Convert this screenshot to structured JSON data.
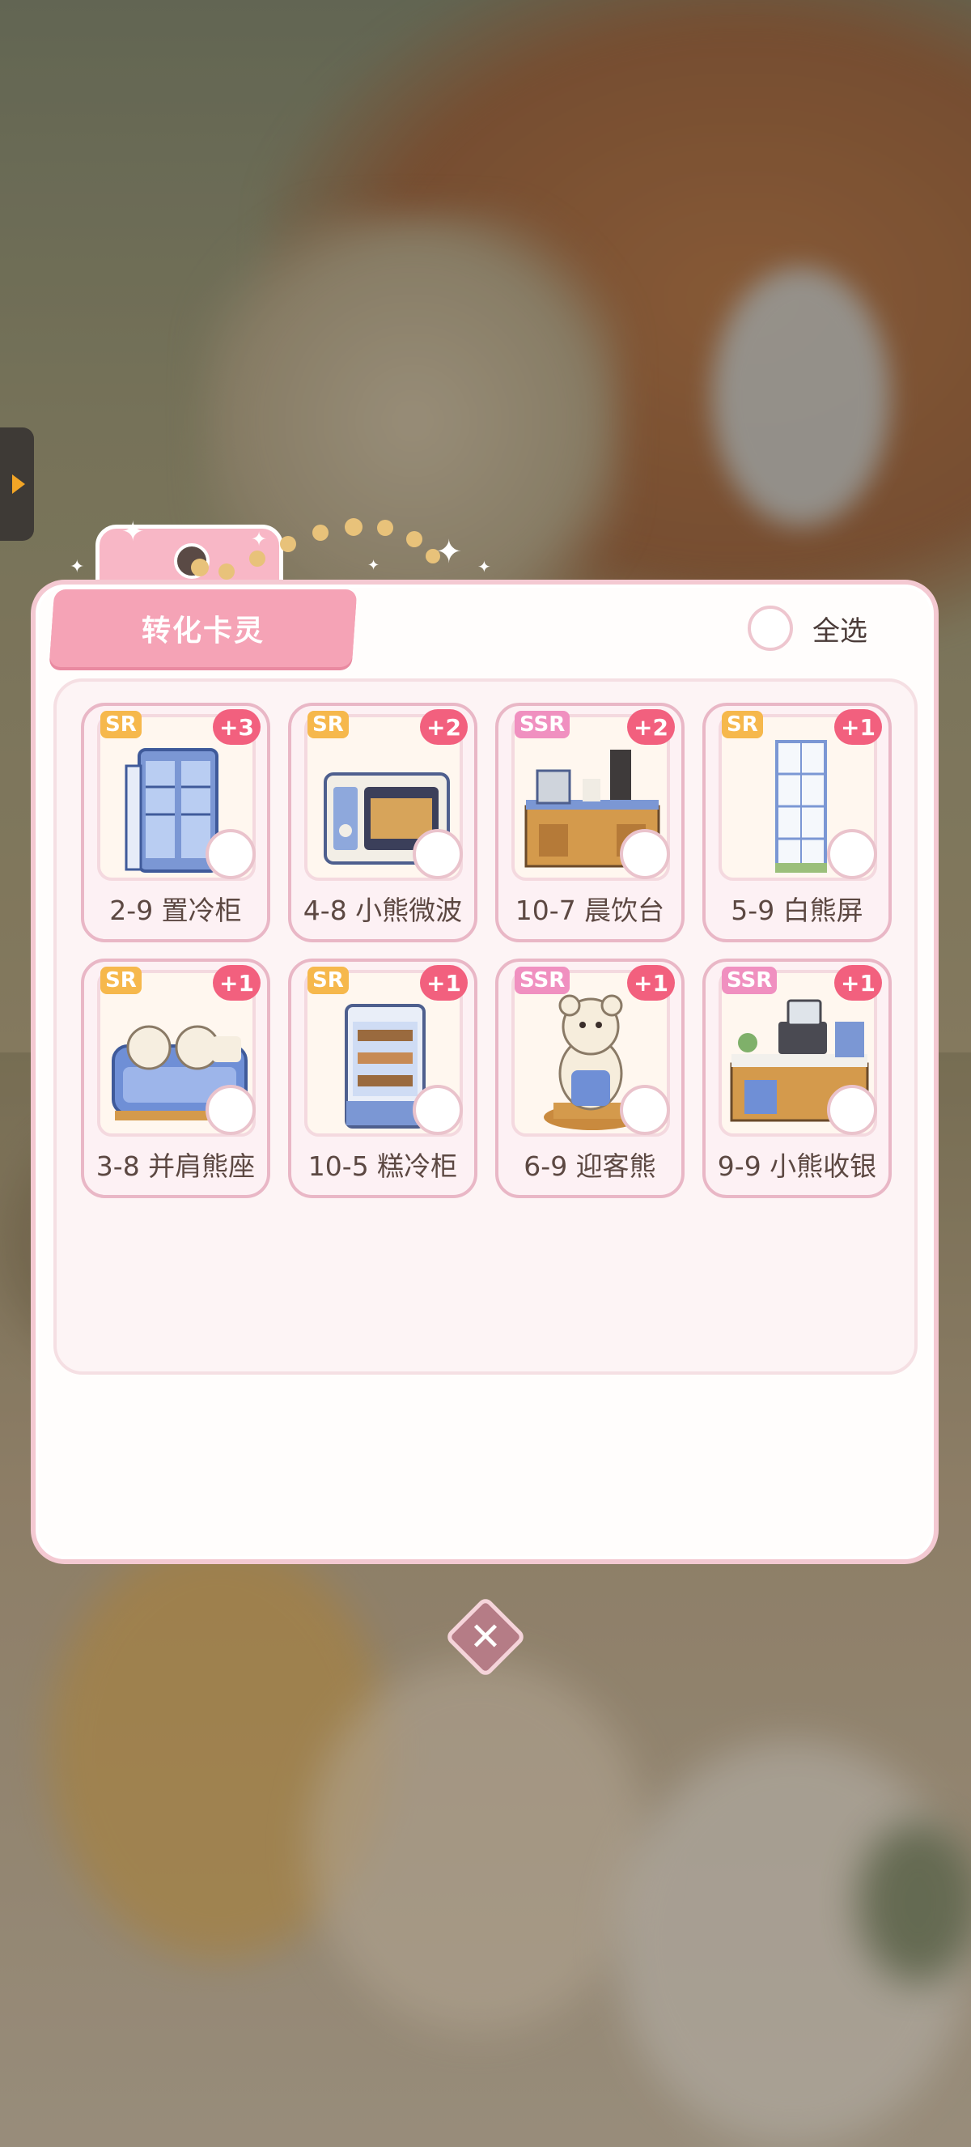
{
  "panel": {
    "title": "转化卡灵",
    "select_all_label": "全选"
  },
  "cards": [
    {
      "rarity": "SR",
      "count": "+3",
      "label": "2-9 置冷柜",
      "icon": "blue-fridge-icon"
    },
    {
      "rarity": "SR",
      "count": "+2",
      "label": "4-8 小熊微波",
      "icon": "microwave-oven-icon"
    },
    {
      "rarity": "SSR",
      "count": "+2",
      "label": "10-7 晨饮台",
      "icon": "coffee-counter-icon"
    },
    {
      "rarity": "SR",
      "count": "+1",
      "label": "5-9 白熊屏",
      "icon": "white-screen-icon"
    },
    {
      "rarity": "SR",
      "count": "+1",
      "label": "3-8 并肩熊座",
      "icon": "bear-sofa-icon"
    },
    {
      "rarity": "SR",
      "count": "+1",
      "label": "10-5 糕冷柜",
      "icon": "cake-fridge-icon"
    },
    {
      "rarity": "SSR",
      "count": "+1",
      "label": "6-9 迎客熊",
      "icon": "greeter-bear-icon"
    },
    {
      "rarity": "SSR",
      "count": "+1",
      "label": "9-9 小熊收银",
      "icon": "cashier-counter-icon"
    }
  ],
  "colors": {
    "sr_badge": "#f6b84c",
    "ssr_badge": "#f090c0",
    "count_badge": "#f2607e",
    "panel_border": "#f4c9d2",
    "title_ribbon": "#f5a3b6"
  },
  "close_button": {
    "symbol": "✕"
  },
  "side_tab": {
    "icon": "expand-arrow-icon"
  }
}
